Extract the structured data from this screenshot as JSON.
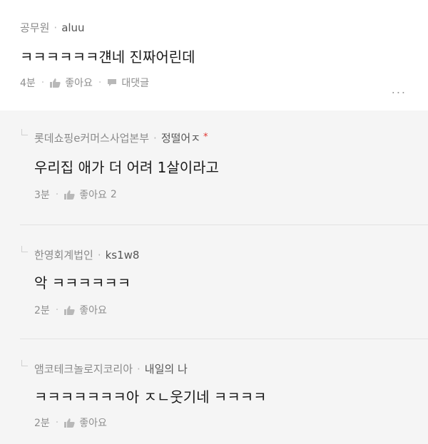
{
  "comments": [
    {
      "org": "공무원",
      "nick": "aluu",
      "op": "",
      "text": "ㅋㅋㅋㅋㅋㅋ걘네 진짜어린데",
      "time": "4분",
      "like_label": "좋아요",
      "like_count": "",
      "reply_label": "대댓글"
    },
    {
      "org": "롯데쇼핑e커머스사업본부",
      "nick": "정떨어ㅈ",
      "op": "*",
      "text": "우리집 애가 더 어려 1살이라고",
      "time": "3분",
      "like_label": "좋아요",
      "like_count": "2"
    },
    {
      "org": "한영회계법인",
      "nick": "ks1w8",
      "op": "",
      "text": "악 ㅋㅋㅋㅋㅋㅋ",
      "time": "2분",
      "like_label": "좋아요",
      "like_count": ""
    },
    {
      "org": "앰코테크놀로지코리아",
      "nick": "내일의 나",
      "op": "",
      "text": "ㅋㅋㅋㅋㅋㅋㅋ아 ㅈㄴ웃기네 ㅋㅋㅋㅋ",
      "time": "2분",
      "like_label": "좋아요",
      "like_count": ""
    }
  ],
  "more_label": "...",
  "meta_sep": "·"
}
